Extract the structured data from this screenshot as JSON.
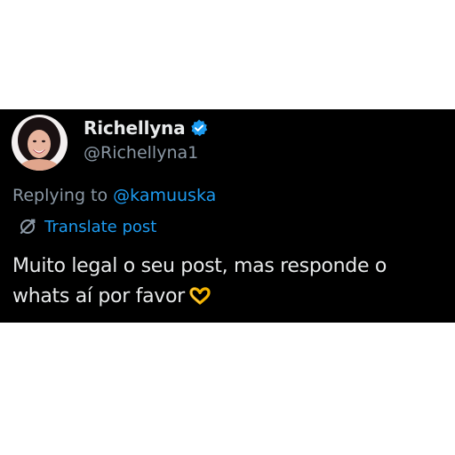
{
  "user": {
    "display_name": "Richellyna",
    "handle": "@Richellyna1",
    "verified": true,
    "avatar_icon": "profile-photo"
  },
  "reply": {
    "label": "Replying to ",
    "target": "@kamuuska"
  },
  "translate": {
    "icon": "translate-icon",
    "label": "Translate post"
  },
  "post": {
    "line1": "Muito legal o seu post, mas responde o",
    "line2": "whats aí por favor",
    "emoji": "🫶"
  },
  "colors": {
    "background": "#000000",
    "text_primary": "#e7e9ea",
    "text_secondary": "#8b98a5",
    "accent": "#1d9bf0"
  }
}
